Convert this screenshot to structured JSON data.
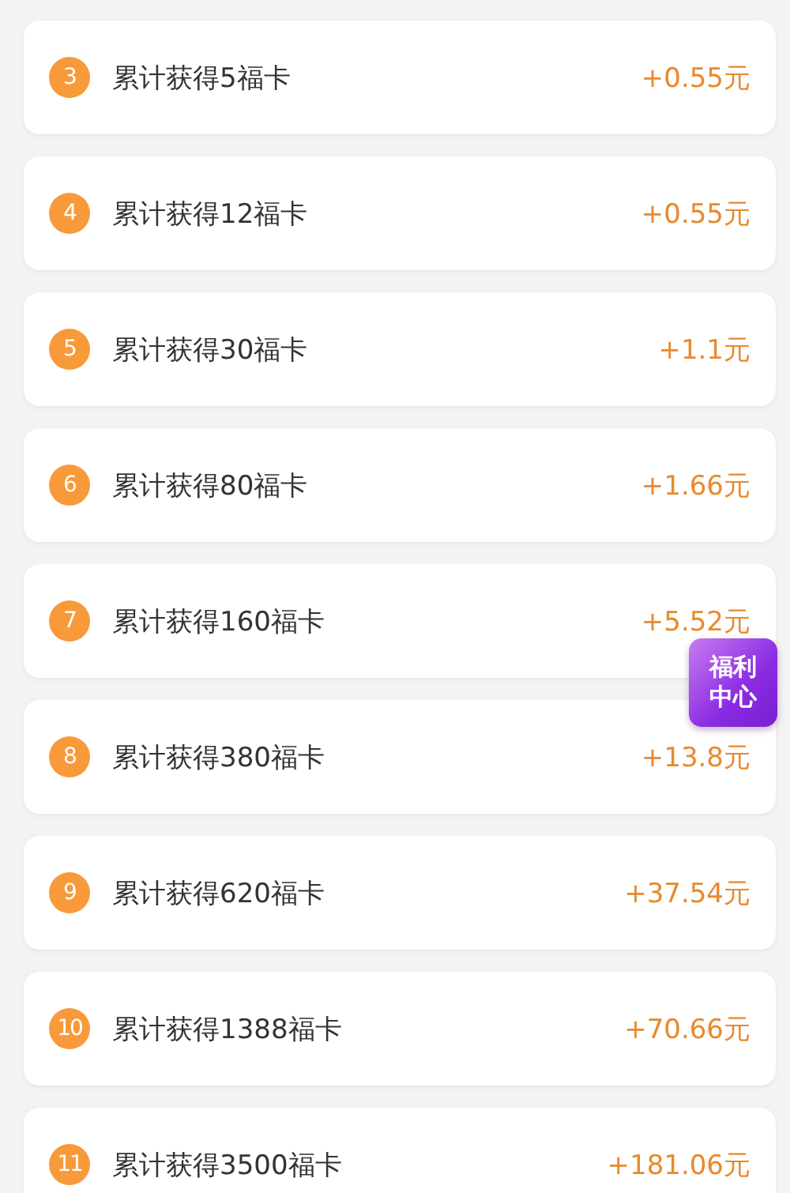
{
  "tasks": [
    {
      "index": "3",
      "label": "累计获得5福卡",
      "reward": "+0.55元"
    },
    {
      "index": "4",
      "label": "累计获得12福卡",
      "reward": "+0.55元"
    },
    {
      "index": "5",
      "label": "累计获得30福卡",
      "reward": "+1.1元"
    },
    {
      "index": "6",
      "label": "累计获得80福卡",
      "reward": "+1.66元"
    },
    {
      "index": "7",
      "label": "累计获得160福卡",
      "reward": "+5.52元"
    },
    {
      "index": "8",
      "label": "累计获得380福卡",
      "reward": "+13.8元"
    },
    {
      "index": "9",
      "label": "累计获得620福卡",
      "reward": "+37.54元"
    },
    {
      "index": "10",
      "label": "累计获得1388福卡",
      "reward": "+70.66元"
    },
    {
      "index": "11",
      "label": "累计获得3500福卡",
      "reward": "+181.06元"
    }
  ],
  "floating_badge": {
    "line_1": "福利",
    "line_2": "中心"
  }
}
